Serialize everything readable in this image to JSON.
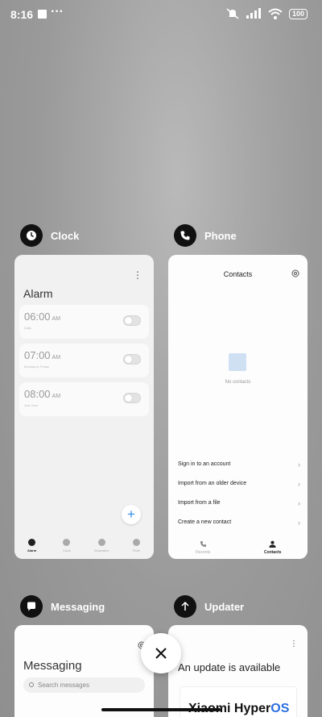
{
  "status_bar": {
    "time": "8:16",
    "more_dots": "···",
    "battery": "100"
  },
  "cards": {
    "clock": {
      "app_name": "Clock",
      "screen_title": "Alarm",
      "alarms": [
        {
          "time": "06:00",
          "ampm": "AM",
          "sub": "Daily"
        },
        {
          "time": "07:00",
          "ampm": "AM",
          "sub": "Monday to Friday"
        },
        {
          "time": "08:00",
          "ampm": "AM",
          "sub": "Just once"
        }
      ],
      "fab": "+",
      "nav": [
        "Alarm",
        "Clock",
        "Stopwatch",
        "Timer"
      ]
    },
    "phone": {
      "app_name": "Phone",
      "screen_title": "Contacts",
      "empty_text": "No contacts",
      "options": [
        "Sign in to an account",
        "Import from an older device",
        "Import from a file",
        "Create a new contact"
      ],
      "nav": [
        "Recents",
        "Contacts"
      ]
    },
    "messaging": {
      "app_name": "Messaging",
      "screen_title": "Messaging",
      "search_placeholder": "Search messages"
    },
    "updater": {
      "app_name": "Updater",
      "screen_title": "An update is available",
      "brand_name": "Xiaomi Hyper",
      "brand_suffix": "OS"
    }
  },
  "colors": {
    "accent": "#2a8be8",
    "brand_os": "#2a6fe0"
  }
}
